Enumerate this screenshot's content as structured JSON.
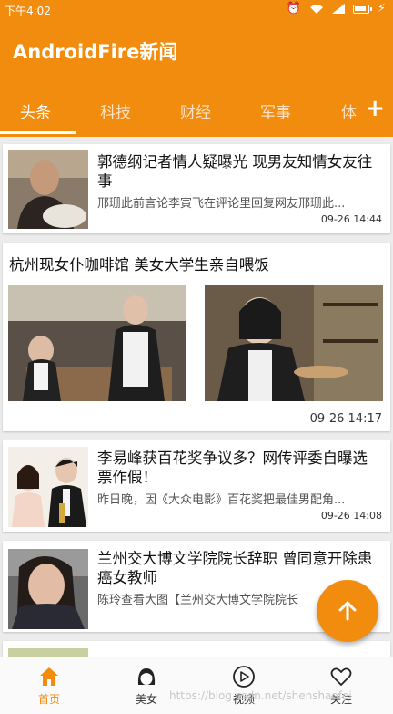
{
  "status_bar": {
    "time": "下午4:02",
    "battery_level": 0.9
  },
  "app_bar": {
    "title": "AndroidFire新闻"
  },
  "tabs": [
    {
      "label": "头条",
      "active": true
    },
    {
      "label": "科技",
      "active": false
    },
    {
      "label": "财经",
      "active": false
    },
    {
      "label": "军事",
      "active": false
    },
    {
      "label": "体",
      "active": false
    }
  ],
  "tab_add_label": "+",
  "news": [
    {
      "title": "郭德纲记者情人疑曝光 现男友知情女友往事",
      "digest": "邢珊此前言论李寅飞在评论里回复网友邢珊此...",
      "time": "09-26 14:44"
    },
    {
      "title": "杭州现女仆咖啡馆 美女大学生亲自喂饭",
      "time": "09-26 14:17"
    },
    {
      "title": "李易峰获百花奖争议多？网传评委自曝选票作假！",
      "digest": "昨日晚，因《大众电影》百花奖把最佳男配角...",
      "time": "09-26 14:08"
    },
    {
      "title": "兰州交大博文学院院长辞职 曾同意开除患癌女教师",
      "digest": "陈玲查看大图【兰州交大博文学院院长"
    }
  ],
  "bottom_nav": [
    {
      "label": "首页",
      "icon": "home-icon",
      "active": true
    },
    {
      "label": "美女",
      "icon": "girl-icon",
      "active": false
    },
    {
      "label": "视频",
      "icon": "play-icon",
      "active": false
    },
    {
      "label": "关注",
      "icon": "heart-icon",
      "active": false
    }
  ],
  "watermark": "https://blog.csdn.net/shenshaofei",
  "colors": {
    "primary": "#f28c0f",
    "background": "#ececec"
  }
}
